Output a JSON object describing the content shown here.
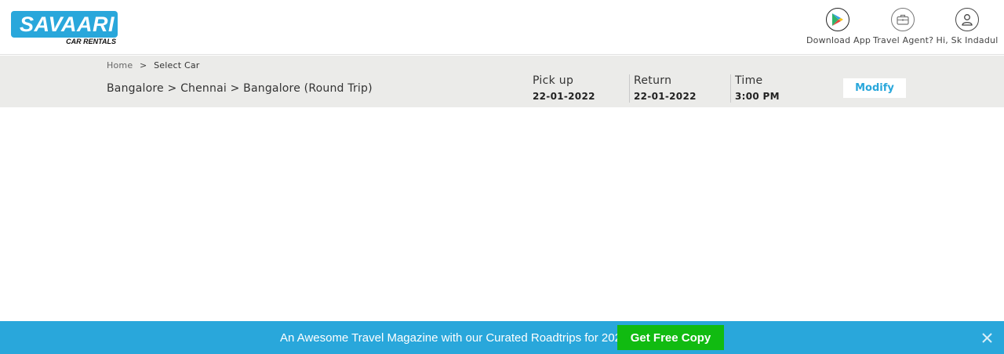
{
  "brand": {
    "name": "SAVAARI",
    "tagline": "CAR RENTALS",
    "color": "#29a7db"
  },
  "header": {
    "items": [
      {
        "label": "Download App",
        "icon": "google-play-icon"
      },
      {
        "label": "Travel Agent?",
        "icon": "briefcase-icon"
      },
      {
        "label": "Hi, Sk Indadul",
        "icon": "user-icon"
      }
    ]
  },
  "breadcrumb": {
    "home": "Home",
    "separator": ">",
    "current": "Select Car"
  },
  "trip": {
    "route": "Bangalore > Chennai > Bangalore (Round Trip)",
    "pickup": {
      "label": "Pick up",
      "value": "22-01-2022"
    },
    "return": {
      "label": "Return",
      "value": "22-01-2022"
    },
    "time": {
      "label": "Time",
      "value": "3:00 PM"
    },
    "modify_label": "Modify"
  },
  "promo": {
    "text": "An Awesome Travel Magazine with our Curated Roadtrips for 2022",
    "button_label": "Get Free Copy",
    "background": "#29a7db",
    "button_color": "#11bb11"
  }
}
